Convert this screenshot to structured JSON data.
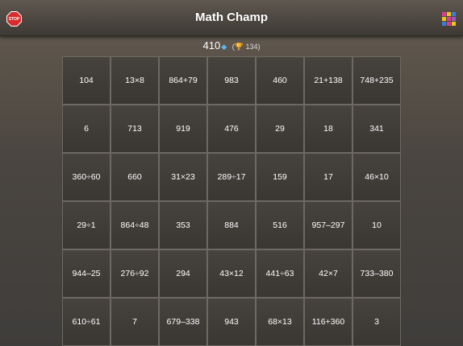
{
  "header": {
    "title": "Math Champ",
    "stop_label": "STOP",
    "grid_icon_colors": [
      "#e03c8e",
      "#f0c419",
      "#3b7ddd",
      "#f0c419",
      "#e03c8e",
      "#9b59b6",
      "#3b7ddd",
      "#e03c8e",
      "#f0c419"
    ]
  },
  "score": {
    "value": "410",
    "best_open": "(",
    "best_value": "134)"
  },
  "board": {
    "rows": [
      [
        "104",
        "13×8",
        "864+79",
        "983",
        "460",
        "21+138",
        "748+235"
      ],
      [
        "6",
        "713",
        "919",
        "476",
        "29",
        "18",
        "341"
      ],
      [
        "360÷60",
        "660",
        "31×23",
        "289÷17",
        "159",
        "17",
        "46×10"
      ],
      [
        "29÷1",
        "864÷48",
        "353",
        "884",
        "516",
        "957–297",
        "10"
      ],
      [
        "944–25",
        "276÷92",
        "294",
        "43×12",
        "441÷63",
        "42×7",
        "733–380"
      ],
      [
        "610÷61",
        "7",
        "679–338",
        "943",
        "68×13",
        "116+360",
        "3"
      ]
    ]
  }
}
